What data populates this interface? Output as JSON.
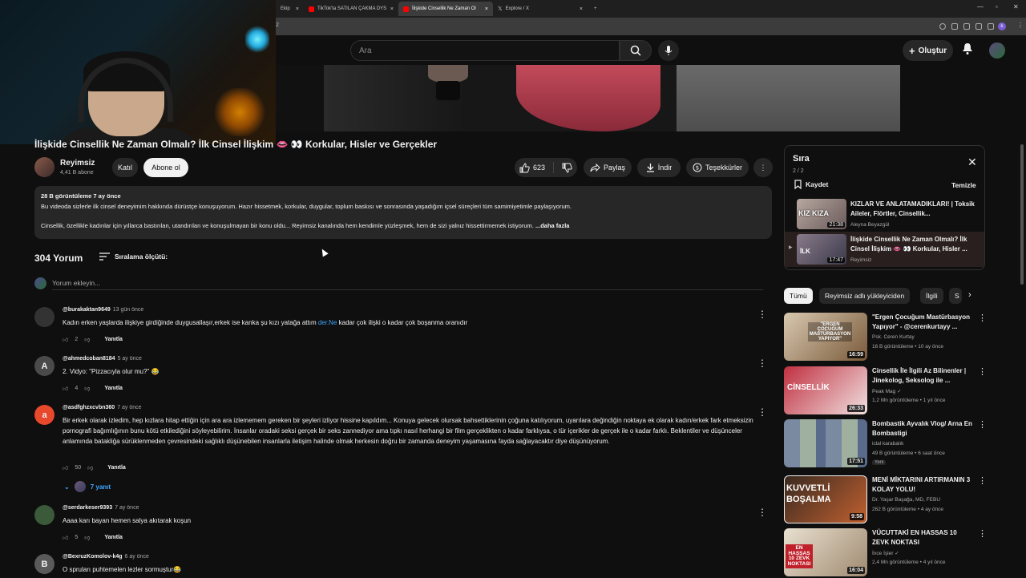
{
  "browser": {
    "tabs": [
      {
        "label": "Ekip",
        "color": "#888888"
      },
      {
        "label": "TikTok'ta SATILAN ÇAKMA DYS",
        "color": "#ff0000"
      },
      {
        "label": "İlişkide Cinsellik Ne Zaman Ol",
        "color": "#ff0000"
      },
      {
        "label": "Explore / X",
        "color": "#ffffff"
      }
    ],
    "new_tab": "+",
    "tab_close": "×",
    "address_number": "2",
    "profile_initial": "k"
  },
  "header": {
    "search_placeholder": "Ara",
    "create_label": "Oluştur"
  },
  "video": {
    "title": "İlişkide Cinsellik Ne Zaman Olmalı? İlk Cinsel İlişkim 👄 👀 Korkular, Hisler ve Gerçekler",
    "channel_name": "Reyimsiz",
    "channel_subs": "4,41 B abone",
    "join_label": "Katıl",
    "subscribe_label": "Abone ol",
    "likes": "623",
    "share_label": "Paylaş",
    "download_label": "İndir",
    "thanks_label": "Teşekkürler",
    "more_label": "⋮"
  },
  "description": {
    "stats": "28 B görüntüleme  7 ay önce",
    "line1": "Bu videoda sizlerle ilk cinsel deneyimim hakkında dürüstçe konuşuyorum. Hazır hissetmek, korkular, duygular, toplum baskısı ve sonrasında yaşadığım içsel süreçleri tüm samimiyetimle paylaşıyorum.",
    "line2": "Cinsellik, özellikle kadınlar için yıllarca bastırılan, utandırılan ve konuşulmayan bir konu oldu... Reyimsiz kanalında hem kendimle yüzleşmek, hem de sizi yalnız hissettirmemek istiyorum.",
    "more": "...daha fazla"
  },
  "comments_section": {
    "count_label": "304 Yorum",
    "sort_label": "Sıralama ölçütü:",
    "add_placeholder": "Yorum ekleyin...",
    "reply_label": "Yanıtla",
    "replies_label": "7 yanıt"
  },
  "comments": [
    {
      "handle": "@burakaktan9649",
      "time": "13 gün önce",
      "text_before": "Kadın erken yaşlarda ilişkiye girdiğinde duygusallaşır,erkek ise kanka şu kızı yatağa attım ",
      "link": "der.Ne",
      "text_after": " kadar çok ilişki o kadar çok boşanma oranıdır",
      "likes": "2",
      "avatar": "",
      "avatar_color": "#333333"
    },
    {
      "handle": "@ahmedcoban8184",
      "time": "5 ay önce",
      "text": "2. Vidyo: \"Pizzacıyla olur mu?\" 😂",
      "likes": "4",
      "avatar": "A",
      "avatar_color": "#4a4a4a"
    },
    {
      "handle": "@asdfghzxcvbn360",
      "time": "7 ay önce",
      "text": "Bir erkek olarak izledim, hep kızlara hitap ettiğin için ara ara izlememem gereken bir şeyleri izliyor hissine kapıldım... Konuya gelecek olursak bahsettiklerinin çoğuna katılıyorum, uyarılara değindiğin noktaya ek olarak kadın/erkek fark etmeksizin pornografi bağımlığının bunu kötü etkilediğini söyleyebilirim. İnsanlar oradaki seksi gerçek bir seks zannediyor ama tıpkı nasıl herhangi bir film gerçeklikten o kadar farklıysa, o tür içerikler de gerçek ile o kadar farklı. Beklentiler ve düşünceler anlamında batakliğa sürüklenmeden çevresindeki sağlıklı düşünebilen insanlarla iletişim halinde olmak herkesin doğru bir zamanda deneyim yaşamasına fayda sağlayacaktır diye düşünüyorum.",
      "likes": "50",
      "avatar": "a",
      "avatar_color": "#e8482b"
    },
    {
      "handle": "@serdarkeser9393",
      "time": "7 ay önce",
      "text": "Aaaa karı bayan hemen salya akıtarak koşun",
      "likes": "5",
      "avatar": "",
      "avatar_color": "#3a5a3a"
    },
    {
      "handle": "@BexruzKomolov-k4g",
      "time": "6 ay önce",
      "text": "O spruları puhtemelen lezler sormuştur😂",
      "likes": "",
      "avatar": "B",
      "avatar_color": "#5a5a5a"
    }
  ],
  "playlist": {
    "title": "Sıra",
    "count": "2 / 2",
    "save_label": "Kaydet",
    "clear_label": "Temizle",
    "items": [
      {
        "title": "KIZLAR VE ANLATAMADIKLARI! | Toksik Aileler, Flörtler, Cinsellik...",
        "channel": "Aleyna Beyazgül",
        "duration": "21:38",
        "thumb_text": "KIZ KIZA"
      },
      {
        "title": "İlişkide Cinsellik Ne Zaman Olmalı? İlk Cinsel İlişkim 👄 👀 Korkular, Hisler ...",
        "channel": "Reyimsiz",
        "duration": "17:47",
        "thumb_text": "İLK"
      }
    ]
  },
  "chips": [
    "Tümü",
    "Reyimsiz adlı yükleyiciden",
    "İlgili",
    "S"
  ],
  "related": [
    {
      "title": "\"Ergen Çocuğum Mastürbasyon Yapıyor\" - @cerenkurtayy ...",
      "channel": "Psk. Ceren Kurtay",
      "stats": "16 B görüntüleme • 10 ay önce",
      "duration": "16:59",
      "thumb_text": "\"ERGEN ÇOCUĞUM MASTÜRBASYON YAPIYOR\"",
      "badge": "",
      "verified": ""
    },
    {
      "title": "Cinsellik İle İlgili Az Bilinenler | Jinekolog, Seksolog ile ...",
      "channel": "Peak Mag",
      "stats": "1,2 Mn görüntüleme • 1 yıl önce",
      "duration": "26:33",
      "thumb_text": "CİNSELLİK",
      "badge": "",
      "verified": "✓"
    },
    {
      "title": "Bombastik Ayvalık Vlog/ Arna En Bombastigi",
      "channel": "iclal karabalık",
      "stats": "49 B görüntüleme • 6 saat önce",
      "duration": "17:51",
      "thumb_text": "",
      "badge": "Yeni",
      "verified": ""
    },
    {
      "title": "MENİ MİKTARINI ARTIRMANIN 3 KOLAY YOLU!",
      "channel": "Dr. Yaşar Başağa, MD, FEBU",
      "stats": "262 B görüntüleme • 4 ay önce",
      "duration": "9:58",
      "thumb_text": "KUVVETLİ BOŞALMA",
      "badge": "",
      "verified": ""
    },
    {
      "title": "VÜCUTTAKİ EN HASSAS 10 ZEVK NOKTASI",
      "channel": "İnce İşler",
      "stats": "2,4 Mn görüntüleme • 4 yıl önce",
      "duration": "16:04",
      "thumb_text": "EN HASSAS 10 ZEVK NOKTASI",
      "badge": "",
      "verified": "✓"
    }
  ],
  "colors": {
    "background": "#0f0f0f",
    "surface": "#272727",
    "link": "#3ea6ff",
    "brand_red": "#ff0000"
  }
}
